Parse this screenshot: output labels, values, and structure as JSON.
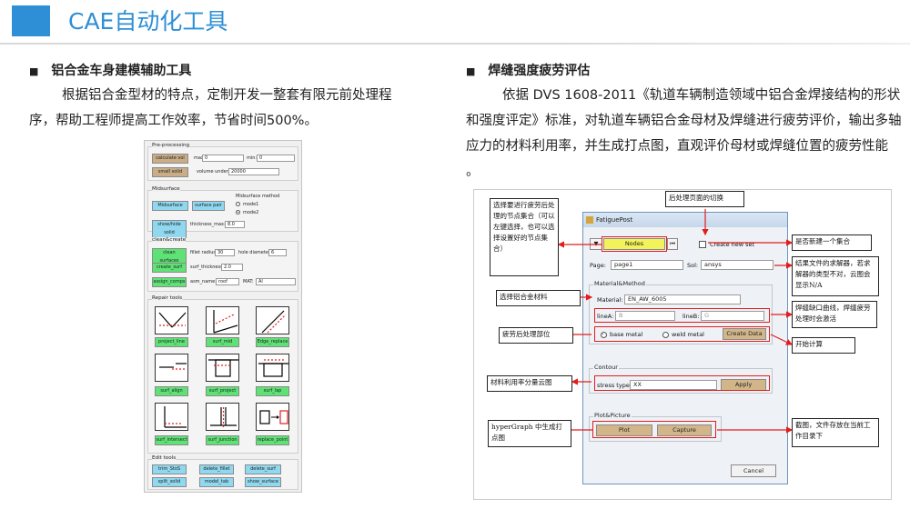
{
  "header": {
    "title": "CAE自动化工具",
    "accent": "#2e8fd6"
  },
  "left": {
    "section_title": "铝合金车身建模辅助工具",
    "paragraph": "根据铝合金型材的特点，定制开发一整套有限元前处理程序，帮助工程师提高工作效率，节省时间500%。",
    "panel": {
      "preprocessing": {
        "label": "Pre-processing",
        "calc_btn": "calculate vol",
        "max_label": "max:",
        "max_value": "0",
        "min_label": "min:",
        "min_value": "0",
        "small_btn": "small solid",
        "vol_label": "volume under:",
        "vol_value": "20000"
      },
      "midsurface": {
        "label": "Midsurface",
        "mid_btn": "Midsurface",
        "pair_btn": "surface pair",
        "method_label": "Midsurface method",
        "mode1": "mode1",
        "mode2": "mode2",
        "show_btn": "show/hide solid",
        "thick_label": "thickness_max:",
        "thick_value": "8.0"
      },
      "cleancreate": {
        "label": "clean&create",
        "clean_btn": "clean surfaces",
        "fillet_label": "fillet radius:",
        "fillet_value": "30",
        "hole_label": "hole diameter:",
        "hole_value": "6",
        "create_btn": "create_surf",
        "surfthick_label": "surf_thickness:",
        "surfthick_value": "2.0",
        "assign_btn": "assign_comps",
        "asm_label": "asm_name:",
        "asm_value": "roof",
        "mat_label": "MAT:",
        "mat_value": "Al"
      },
      "repair": {
        "label": "Repair tools",
        "tools": [
          "project_line",
          "surf_mid",
          "Edge_replace",
          "surf_align",
          "surf_project",
          "surf_lap",
          "surf_intersect",
          "surf_junction",
          "replace_point"
        ]
      },
      "edit": {
        "label": "Edit tools",
        "tools": [
          "trim_StoS",
          "delete_fillet",
          "delete_surf",
          "split_solid",
          "model_tab",
          "show_surface"
        ]
      }
    }
  },
  "right": {
    "section_title": "焊缝强度疲劳评估",
    "paragraph": "依据 DVS 1608-2011《轨道车辆制造领域中铝合金焊接结构的形状和强度评定》标准，对轨道车辆铝合金母材及焊缝进行疲劳评价，输出多轴应力的材料利用率，并生成打点图，直观评价母材或焊缝位置的疲劳性能 。",
    "dialog": {
      "title": "FatiguePost",
      "nodes_btn": "Nodes",
      "create_new_set": "Create new set",
      "page_label": "Page:",
      "page_value": "page1",
      "sol_label": "Sol:",
      "sol_value": "ansys",
      "matmethod_label": "Material&Method",
      "material_label": "Material:",
      "material_value": "EN_AW_6005",
      "lineA_label": "lineA:",
      "lineA_value": "B",
      "lineB_label": "lineB:",
      "lineB_value": "G",
      "base_metal": "base metal",
      "weld_metal": "weld metal",
      "create_data_btn": "Create Data",
      "contour_label": "Contour",
      "stress_label": "stress type:",
      "stress_value": "XX",
      "apply_btn": "Apply",
      "plot_label": "Plot&Picture",
      "plot_btn": "Plot",
      "capture_btn": "Capture",
      "cancel_btn": "Cancel"
    },
    "callouts": {
      "node_set": "选择要进行疲劳后处理的节点集合（可以左键选择，也可以选择设置好的节点集合）",
      "page_switch": "后处理页面的切换",
      "new_set": "是否新建一个集合",
      "solver": "结果文件的求解器，若求解器的类型不对，云图会显示N/A",
      "material": "选择铝合金材料",
      "weld_curve": "焊缝缺口曲线，焊缝疲劳处理时会激活",
      "part": "疲劳后处理部位",
      "start": "开始计算",
      "utilization": "材料利用率分量云图",
      "hypergraph": "hyperGraph 中生成打点图",
      "screenshot": "截图，文件存放在当前工作目录下"
    }
  }
}
